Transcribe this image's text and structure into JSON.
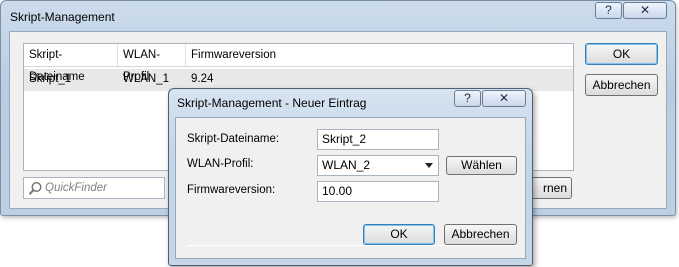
{
  "main_window": {
    "title": "Skript-Management",
    "help_label": "?",
    "close_label": "✕",
    "table": {
      "columns": [
        "Skript-Dateiname",
        "WLAN-Profil",
        "Firmwareversion"
      ],
      "rows": [
        [
          "Skript_1",
          "WLAN_1",
          "9.24"
        ]
      ]
    },
    "ok_label": "OK",
    "cancel_label": "Abbrechen",
    "quickfinder_placeholder": "QuickFinder",
    "remove_label_partial": "rnen"
  },
  "dialog": {
    "title": "Skript-Management - Neuer Eintrag",
    "help_label": "?",
    "close_label": "✕",
    "fields": {
      "filename_label": "Skript-Dateiname:",
      "filename_value": "Skript_2",
      "profile_label": "WLAN-Profil:",
      "profile_value": "WLAN_2",
      "choose_label": "Wählen",
      "firmware_label": "Firmwareversion:",
      "firmware_value": "10.00"
    },
    "ok_label": "OK",
    "cancel_label": "Abbrechen"
  }
}
